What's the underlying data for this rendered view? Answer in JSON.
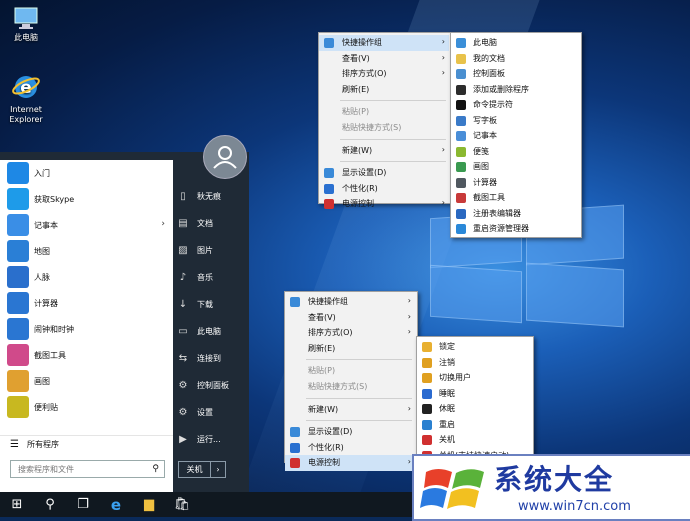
{
  "desktop": {
    "icons": [
      {
        "label": "此电脑"
      },
      {
        "label": "Internet Explorer"
      }
    ]
  },
  "start_menu": {
    "apps": [
      {
        "label": "入门",
        "icon": "lightbulb-icon",
        "color": "#1e88e5"
      },
      {
        "label": "获取Skype",
        "icon": "skype-icon",
        "color": "#1e9be9"
      },
      {
        "label": "记事本",
        "icon": "notepad-icon",
        "color": "#3a8ee6",
        "has_submenu": true
      },
      {
        "label": "地图",
        "icon": "map-icon",
        "color": "#2a7fd6"
      },
      {
        "label": "人脉",
        "icon": "people-icon",
        "color": "#2a6fcc"
      },
      {
        "label": "计算器",
        "icon": "calculator-icon",
        "color": "#2a76d2"
      },
      {
        "label": "闹钟和时钟",
        "icon": "alarm-icon",
        "color": "#2a76d2"
      },
      {
        "label": "截图工具",
        "icon": "scissors-icon",
        "color": "#d04a8a"
      },
      {
        "label": "画图",
        "icon": "paint-icon",
        "color": "#e0a030"
      },
      {
        "label": "便利贴",
        "icon": "sticky-notes-icon",
        "color": "#c8b820"
      }
    ],
    "all_programs": "所有程序",
    "search_placeholder": "搜索程序和文件",
    "user_folders": [
      {
        "label": "秋无痕",
        "icon": "user-folder-icon",
        "glyph": "▯"
      },
      {
        "label": "文档",
        "icon": "documents-icon",
        "glyph": "▤"
      },
      {
        "label": "图片",
        "icon": "pictures-icon",
        "glyph": "▨"
      },
      {
        "label": "音乐",
        "icon": "music-icon",
        "glyph": "♪"
      },
      {
        "label": "下载",
        "icon": "download-icon",
        "glyph": "↓"
      },
      {
        "label": "此电脑",
        "icon": "computer-icon",
        "glyph": "▭"
      },
      {
        "label": "连接到",
        "icon": "connect-icon",
        "glyph": "⇆"
      },
      {
        "label": "控制面板",
        "icon": "control-panel-icon",
        "glyph": "⚙"
      },
      {
        "label": "设置",
        "icon": "settings-icon",
        "glyph": "⚙"
      },
      {
        "label": "运行...",
        "icon": "run-icon",
        "glyph": "▶"
      }
    ],
    "shutdown_label": "关机",
    "shutdown_arrow": "›"
  },
  "context_menu_top": {
    "items": [
      {
        "label": "快捷操作组",
        "arrow": "›",
        "state": "highlight",
        "icon": "quick-actions-icon"
      },
      {
        "label": "查看(V)",
        "arrow": "›"
      },
      {
        "label": "排序方式(O)",
        "arrow": "›"
      },
      {
        "label": "刷新(E)"
      },
      {
        "separator": true
      },
      {
        "label": "粘贴(P)",
        "state": "disabled"
      },
      {
        "label": "粘贴快捷方式(S)",
        "state": "disabled"
      },
      {
        "separator": true
      },
      {
        "label": "新建(W)",
        "arrow": "›"
      },
      {
        "separator": true
      },
      {
        "label": "显示设置(D)",
        "icon": "display-settings-icon"
      },
      {
        "label": "个性化(R)",
        "icon": "personalize-icon"
      },
      {
        "label": "电源控制",
        "arrow": "›",
        "icon": "power-control-icon"
      }
    ]
  },
  "submenu_top": {
    "items": [
      {
        "label": "此电脑",
        "icon": "computer-icon",
        "color": "#3b8fd8"
      },
      {
        "label": "我的文档",
        "icon": "folder-icon",
        "color": "#e8c24a"
      },
      {
        "label": "控制面板",
        "icon": "control-panel-icon",
        "color": "#4a8fd0"
      },
      {
        "label": "添加或删除程序",
        "icon": "programs-icon",
        "color": "#2c2c2c"
      },
      {
        "label": "命令提示符",
        "icon": "cmd-icon",
        "color": "#111111"
      },
      {
        "label": "写字板",
        "icon": "wordpad-icon",
        "color": "#3a7ac8"
      },
      {
        "label": "记事本",
        "icon": "notepad-icon",
        "color": "#4a8ed8"
      },
      {
        "label": "便笺",
        "icon": "sticky-notes-icon",
        "color": "#8ab830"
      },
      {
        "label": "画图",
        "icon": "paint-icon",
        "color": "#3a9a50"
      },
      {
        "label": "计算器",
        "icon": "calculator-icon",
        "color": "#505860"
      },
      {
        "label": "截图工具",
        "icon": "scissors-icon",
        "color": "#c83a3a"
      },
      {
        "label": "注册表编辑器",
        "icon": "registry-icon",
        "color": "#2a68c0"
      },
      {
        "label": "重启资源管理器",
        "icon": "restart-explorer-icon",
        "color": "#2a88d8"
      }
    ]
  },
  "context_menu_bottom": {
    "items": [
      {
        "label": "快捷操作组",
        "arrow": "›",
        "icon": "quick-actions-icon"
      },
      {
        "label": "查看(V)",
        "arrow": "›"
      },
      {
        "label": "排序方式(O)",
        "arrow": "›"
      },
      {
        "label": "刷新(E)"
      },
      {
        "separator": true
      },
      {
        "label": "粘贴(P)",
        "state": "disabled"
      },
      {
        "label": "粘贴快捷方式(S)",
        "state": "disabled"
      },
      {
        "separator": true
      },
      {
        "label": "新建(W)",
        "arrow": "›"
      },
      {
        "separator": true
      },
      {
        "label": "显示设置(D)",
        "icon": "display-settings-icon"
      },
      {
        "label": "个性化(R)",
        "icon": "personalize-icon"
      },
      {
        "label": "电源控制",
        "arrow": "›",
        "state": "highlight",
        "icon": "power-control-icon"
      }
    ]
  },
  "submenu_bottom": {
    "items": [
      {
        "label": "锁定",
        "icon": "lock-icon",
        "color": "#e8b030"
      },
      {
        "label": "注销",
        "icon": "logoff-icon",
        "color": "#e0a020"
      },
      {
        "label": "切换用户",
        "icon": "switch-user-icon",
        "color": "#e0a020"
      },
      {
        "label": "睡眠",
        "icon": "sleep-icon",
        "color": "#2a6ad0"
      },
      {
        "label": "休眠",
        "icon": "hibernate-icon",
        "color": "#222222"
      },
      {
        "label": "重启",
        "icon": "restart-icon",
        "color": "#2a80d0"
      },
      {
        "label": "关机",
        "icon": "power-icon",
        "color": "#d03030"
      },
      {
        "label": "关机(支持快速启动)",
        "icon": "power-fast-icon",
        "color": "#d03030"
      }
    ]
  },
  "taskbar": {
    "buttons": [
      {
        "icon": "windows-start-icon",
        "glyph": "⊞"
      },
      {
        "icon": "search-icon",
        "glyph": "⚲"
      },
      {
        "icon": "task-view-icon",
        "glyph": "❐"
      },
      {
        "icon": "edge-icon",
        "glyph": "e"
      },
      {
        "icon": "file-explorer-icon",
        "glyph": "▆"
      },
      {
        "icon": "store-icon",
        "glyph": "🛍"
      }
    ]
  },
  "watermark": {
    "title": "系统大全",
    "url": "www.win7cn.com"
  }
}
